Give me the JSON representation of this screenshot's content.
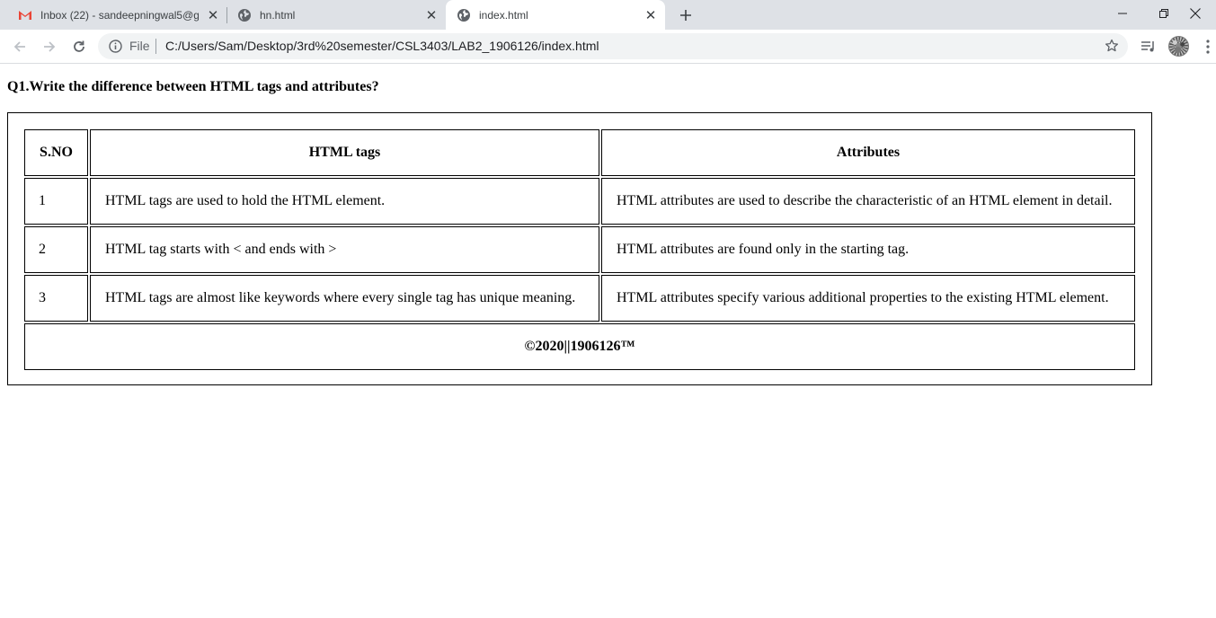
{
  "browser": {
    "tabs": [
      {
        "title": "Inbox (22) - sandeepningwal5@g",
        "icon": "gmail-icon",
        "active": false
      },
      {
        "title": "hn.html",
        "icon": "globe-icon",
        "active": false
      },
      {
        "title": "index.html",
        "icon": "globe-icon",
        "active": true
      }
    ],
    "address": {
      "scheme_label": "File",
      "url": "C:/Users/Sam/Desktop/3rd%20semester/CSL3403/LAB2_1906126/index.html"
    }
  },
  "page": {
    "question": "Q1.Write the difference between HTML tags and attributes?",
    "table": {
      "headers": [
        "S.NO",
        "HTML tags",
        "Attributes"
      ],
      "rows": [
        [
          "1",
          "HTML tags are used to hold the HTML element.",
          "HTML attributes are used to describe the characteristic of an HTML element in detail."
        ],
        [
          "2",
          "HTML tag starts with < and ends with >",
          "HTML attributes are found only in the starting tag."
        ],
        [
          "3",
          "HTML tags are almost like keywords where every single tag has unique meaning.",
          "HTML attributes specify various additional properties to the existing HTML element."
        ]
      ],
      "footer": "©2020||1906126™"
    }
  },
  "colors": {
    "tabstrip_bg": "#dee1e6",
    "omnibox_bg": "#f1f3f4",
    "gmail_red": "#ea4335"
  }
}
